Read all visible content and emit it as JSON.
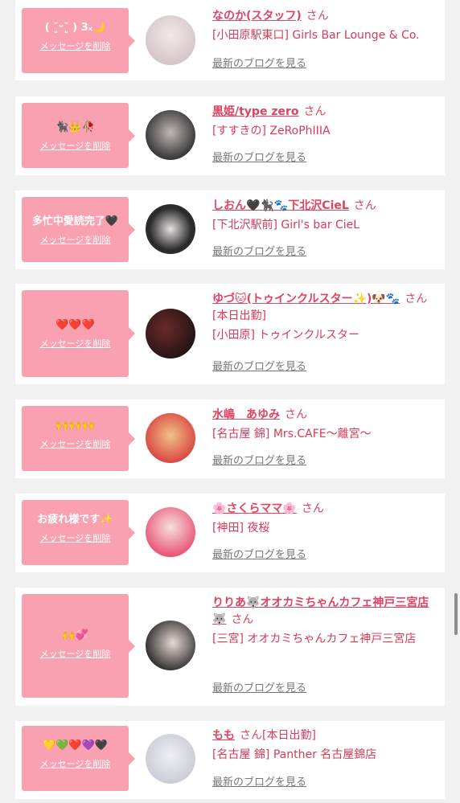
{
  "delete_label": "メッセージを削除",
  "blog_label": "最新のブログを見る",
  "san": "さん",
  "colors": {
    "accent": "#e0435f",
    "bubble": "#f9a0b1"
  },
  "items": [
    {
      "message": "( ˘͈ᵕ˘͈ ) 3ₓ🌙",
      "name": "なのか(スタッフ)",
      "status": "",
      "shop": "[小田原駅東口] Girls Bar Lounge & Co.",
      "avatar_colors": [
        "#f3e9ea",
        "#c9b8bb"
      ]
    },
    {
      "message": "🐈‍⬛👑🥀",
      "name": "黒姫/type zero",
      "status": "",
      "shop": "[すすきの] ZeRoPhIIIA",
      "avatar_colors": [
        "#3a3a3a",
        "#bfb8b6"
      ]
    },
    {
      "message": "多忙中愛読完了🖤",
      "name": "しおん🖤🐈‍⬛🐾下北沢CieL",
      "status": "",
      "shop": "[下北沢駅前] Girl's bar CieL",
      "avatar_colors": [
        "#2b2b2b",
        "#e6e1e1"
      ]
    },
    {
      "message": "❤️❤️❤️",
      "name": "ゆづ🐱(トゥインクルスター✨)🐶🐾",
      "status": "[本日出勤]",
      "shop": "[小田原] トゥインクルスター",
      "avatar_colors": [
        "#6a2a2a",
        "#3a2020"
      ]
    },
    {
      "message": "🙌🙌🙌",
      "name": "水嶋　あゆみ",
      "status": "",
      "shop": "[名古屋 錦] Mrs.CAFE〜離宮〜",
      "avatar_colors": [
        "#d9443f",
        "#f0c28a"
      ]
    },
    {
      "message": "お疲れ様です✨",
      "name": "🌸さくらママ🌸",
      "status": "",
      "shop": "[神田] 夜桜",
      "avatar_colors": [
        "#e84a6e",
        "#f6e0de"
      ]
    },
    {
      "message": "🙌💞",
      "name": "りりあ🐺オオカミちゃんカフェ神戸三宮店🐺",
      "status": "",
      "shop": "[三宮] オオカミちゃんカフェ神戸三宮店",
      "avatar_colors": [
        "#2a2a2a",
        "#e8d9d6"
      ]
    },
    {
      "message": "💛💚❤️💜🖤",
      "name": "もも",
      "status": "[本日出勤]",
      "shop": "[名古屋 錦] Panther 名古屋錦店",
      "avatar_colors": [
        "#c9c9d6",
        "#eeeef3"
      ]
    }
  ]
}
